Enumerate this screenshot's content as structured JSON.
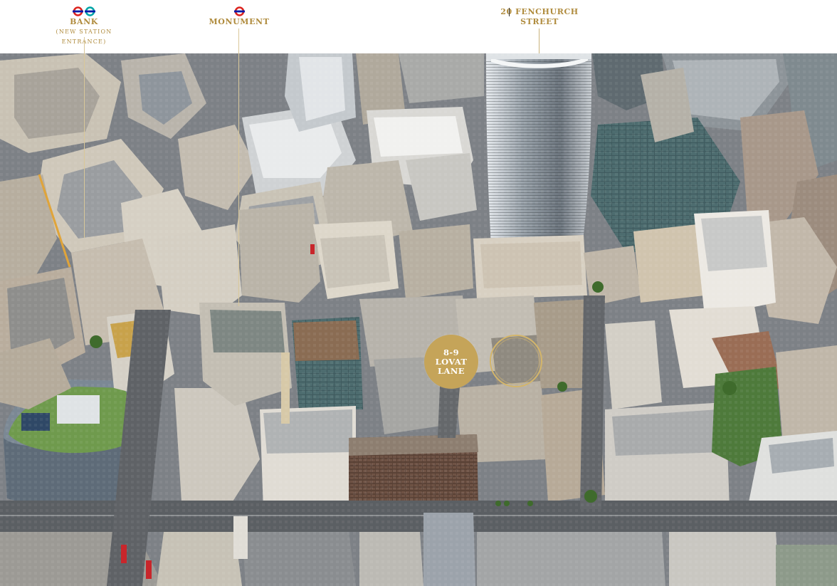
{
  "labels": {
    "bank": {
      "name": "BANK",
      "sub": "(NEW STATION ENTRANCE)",
      "icons": [
        "underground-roundel-icon",
        "overground-roundel-icon"
      ]
    },
    "monument": {
      "name": "MONUMENT",
      "icons": [
        "underground-roundel-icon"
      ]
    },
    "fenchurch": {
      "line1": "20 FENCHURCH",
      "line2": "STREET"
    }
  },
  "site": {
    "line1": "8-9",
    "line2": "LOVAT",
    "line3": "LANE"
  },
  "colors": {
    "gold": "#b08c3e",
    "badge": "#c5a459",
    "underground_red": "#dc241f",
    "underground_blue": "#0019a8",
    "overground_teal": "#00a4a7"
  }
}
